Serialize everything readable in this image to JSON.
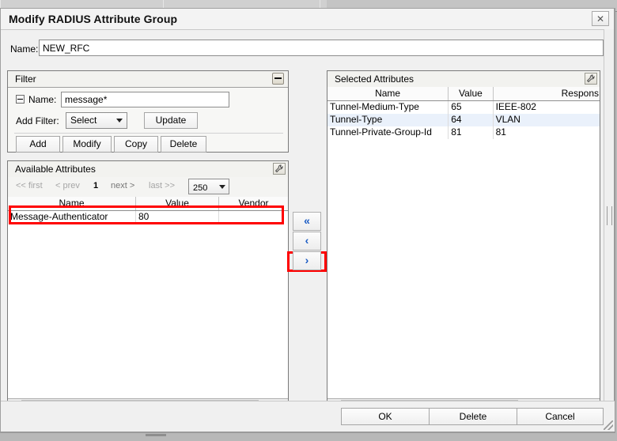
{
  "window": {
    "title": "Modify RADIUS Attribute Group",
    "close_label": "✕"
  },
  "name_field": {
    "label": "Name:",
    "value": "NEW_RFC",
    "placeholder": ""
  },
  "filter": {
    "title": "Filter",
    "collapse_icon": "minus-icon",
    "name_label": "Name:",
    "name_value": "message*",
    "name_placeholder": "",
    "add_filter_label": "Add Filter:",
    "add_filter_value": "Select",
    "update_label": "Update",
    "actions": [
      {
        "label": "Add"
      },
      {
        "label": "Modify"
      },
      {
        "label": "Copy"
      },
      {
        "label": "Delete"
      }
    ]
  },
  "available": {
    "title": "Available Attributes",
    "tool_icon": "wrench-icon",
    "pagination": {
      "first": "<< first",
      "prev": "< prev",
      "current": "1",
      "next": "next >",
      "last": "last >>",
      "page_size": "250"
    },
    "columns": [
      "Name",
      "Value",
      "Vendor"
    ],
    "rows": [
      {
        "name": "Message-Authenticator",
        "value": "80",
        "vendor": ""
      }
    ],
    "scrollbar": {
      "left_arrow": "◀",
      "right_arrow": "▶"
    }
  },
  "transfer": {
    "buttons": [
      {
        "label": "«",
        "name": "move-all-left"
      },
      {
        "label": "‹",
        "name": "move-left"
      },
      {
        "label": "›",
        "name": "move-right"
      }
    ]
  },
  "selected": {
    "title": "Selected Attributes",
    "tool_icon": "wrench-icon",
    "columns": [
      "Name",
      "Value",
      "Respons"
    ],
    "rows": [
      {
        "name": "Tunnel-Medium-Type",
        "value": "65",
        "response": "IEEE-802"
      },
      {
        "name": "Tunnel-Type",
        "value": "64",
        "response": "VLAN"
      },
      {
        "name": "Tunnel-Private-Group-Id",
        "value": "81",
        "response": "81"
      }
    ],
    "scrollbar": {
      "left_arrow": "◀",
      "right_arrow": "▶"
    }
  },
  "footer": {
    "ok_label": "OK",
    "delete_label": "Delete",
    "cancel_label": "Cancel"
  },
  "colors": {
    "highlight": "#ff0000",
    "row_alt": "#eaf1fb",
    "arrow_blue": "#1b5cc4"
  }
}
